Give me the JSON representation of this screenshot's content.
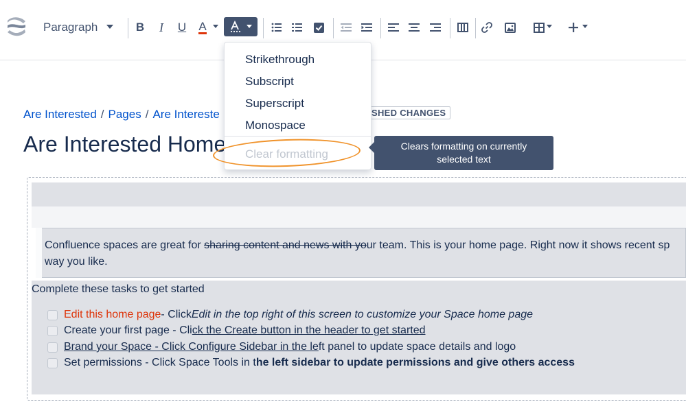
{
  "toolbar": {
    "paragraph_label": "Paragraph",
    "bold_label": "B",
    "italic_label": "I",
    "underline_label": "U",
    "text_color_label": "A",
    "text_color_accent": "#de350b",
    "active_accent": "#42526e",
    "icons": [
      "confluence-logo",
      "more-formatting-icon",
      "bullet-list-icon",
      "numbered-list-icon",
      "task-list-icon",
      "outdent-icon",
      "indent-icon",
      "align-left-icon",
      "align-center-icon",
      "align-right-icon",
      "page-layout-icon",
      "link-icon",
      "image-icon",
      "table-icon",
      "insert-more-icon"
    ]
  },
  "dropdown": {
    "items": [
      "Strikethrough",
      "Subscript",
      "Superscript",
      "Monospace"
    ],
    "disabled_item": "Clear formatting"
  },
  "tooltip": {
    "line1": "Clears formatting on currently",
    "line2": "selected text"
  },
  "breadcrumb": {
    "items": [
      "Are Interested",
      "Pages",
      "Are Intereste"
    ],
    "separator": "/"
  },
  "status_badge": "SHED CHANGES",
  "page_title": "Are Interested Home",
  "content": {
    "intro_part1": "Confluence spaces are great for ",
    "intro_strike": "sharing content and news with yo",
    "intro_part2": "ur team. This is your home page. Right now it shows recent sp",
    "intro_line2": "way you like.",
    "tasks_heading": "Complete these tasks to get started",
    "tasks": [
      {
        "a": "Edit this home page",
        "b": " - Click ",
        "c": "Edit in the top right of this screen to customize your Space home page"
      },
      {
        "a": "Create your first page - Cli",
        "b": "ck the Create button in the header to get started"
      },
      {
        "a": "Brand your Space - Click Configure Sidebar in the le",
        "b": "ft panel to update space details and logo"
      },
      {
        "a": "Set permissions - Click Space Tools in t",
        "b": "he left sidebar to update permissions and give others access"
      }
    ]
  }
}
